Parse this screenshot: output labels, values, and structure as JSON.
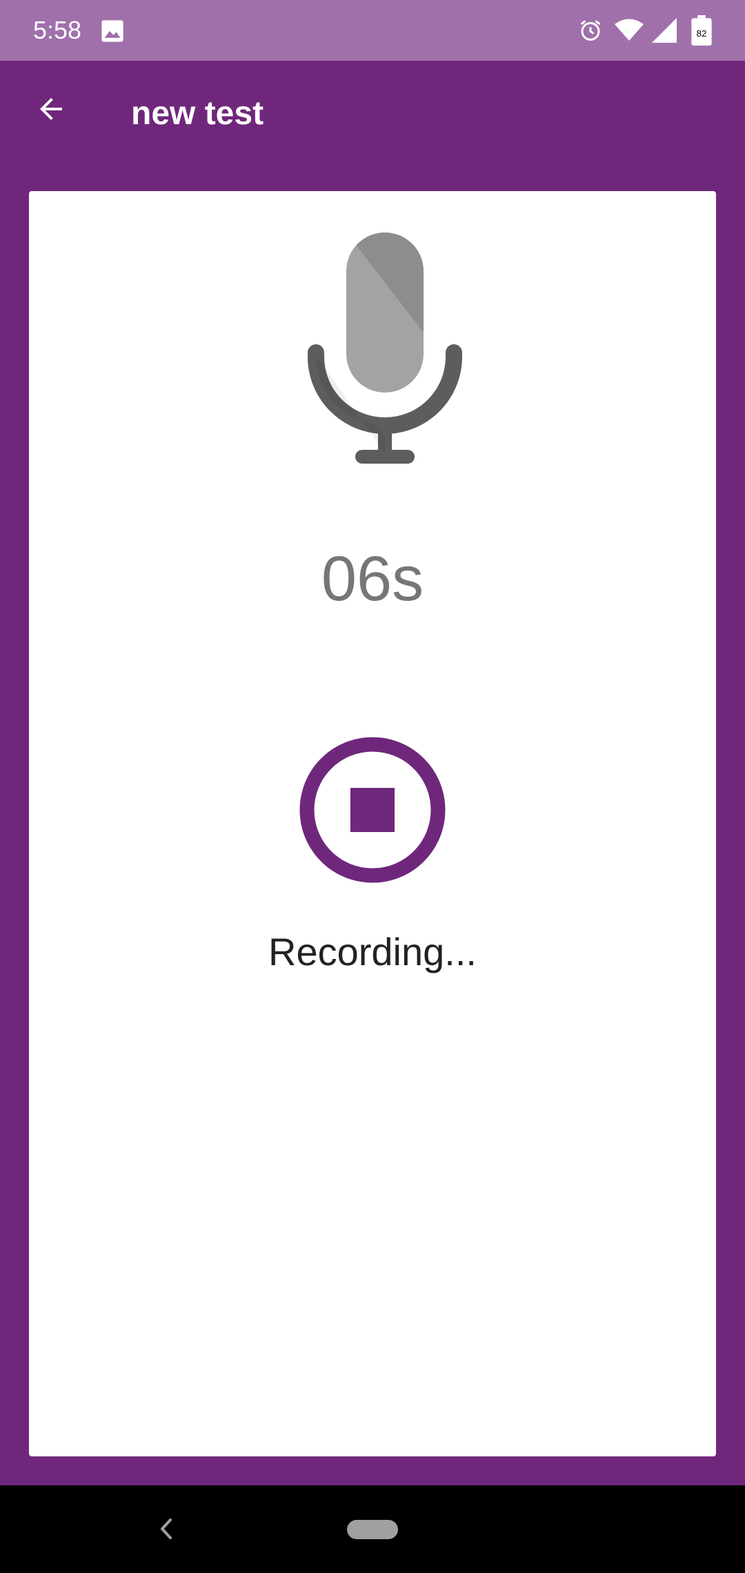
{
  "status_bar": {
    "time": "5:58",
    "battery_level": "82",
    "icons": [
      "image-icon",
      "alarm-icon",
      "wifi-icon",
      "signal-icon",
      "battery-icon"
    ]
  },
  "app_bar": {
    "title": "new test",
    "back_icon": "arrow-back-icon"
  },
  "recorder": {
    "timer": "06s",
    "status": "Recording...",
    "mic_icon": "microphone-icon",
    "stop_icon": "stop-icon"
  },
  "nav_bar": {
    "back_icon": "chevron-left-icon",
    "home_icon": "home-pill-icon"
  },
  "colors": {
    "primary": "#6f277c",
    "status_bar": "#a070aa",
    "card": "#ffffff",
    "timer_text": "#767676",
    "label_text": "#222222",
    "mic_light": "#9e9e9e",
    "mic_dark": "#5f5f5f"
  }
}
